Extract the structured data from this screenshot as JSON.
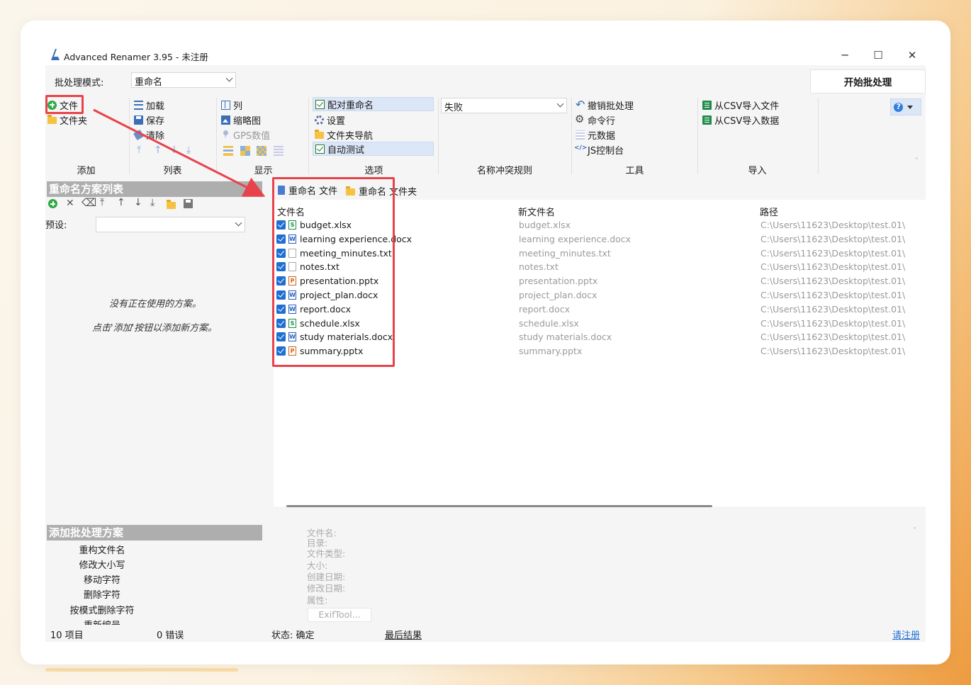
{
  "window": {
    "title": "Advanced Renamer 3.95 - 未注册",
    "minimize": "─",
    "maximize": "☐",
    "close": "✕"
  },
  "batch_mode": {
    "label": "批处理模式:",
    "value": "重命名"
  },
  "start_button": "开始批处理",
  "groups": {
    "add": {
      "label": "添加",
      "files": "文件",
      "folder": "文件夹"
    },
    "list": {
      "label": "列表",
      "load": "加载",
      "save": "保存",
      "clear": "清除"
    },
    "display": {
      "label": "显示",
      "columns": "列",
      "thumbnails": "缩略图",
      "gps": "GPS数值"
    },
    "options": {
      "label": "选项",
      "pair_rename": "配对重命名",
      "settings": "设置",
      "folder_nav": "文件夹导航",
      "auto_test": "自动测试"
    },
    "conflict": {
      "label": "名称冲突规则",
      "value": "失败"
    },
    "tools": {
      "label": "工具",
      "undo": "撤销批处理",
      "cmdline": "命令行",
      "metadata": "元数据",
      "js_console": "JS控制台"
    },
    "import": {
      "label": "导入",
      "csv_files": "从CSV导入文件",
      "csv_data": "从CSV导入数据"
    }
  },
  "left_panel": {
    "methods_header": "重命名方案列表",
    "preset_label": "预设:",
    "empty_msg1": "没有正在使用的方案。",
    "empty_msg2": "点击'添加'按钮以添加新方案。",
    "add_header": "添加批处理方案",
    "add_methods": [
      "重构文件名",
      "修改大小写",
      "移动字符",
      "删除字符",
      "按模式删除字符",
      "重新编号"
    ]
  },
  "tabs": [
    "重命名 文件",
    "重命名 文件夹"
  ],
  "columns": {
    "filename": "文件名",
    "new_filename": "新文件名",
    "path": "路径"
  },
  "files": [
    {
      "name": "budget.xlsx",
      "new": "budget.xlsx",
      "path": "C:\\Users\\11623\\Desktop\\test.01\\",
      "type": "x"
    },
    {
      "name": "learning experience.docx",
      "new": "learning experience.docx",
      "path": "C:\\Users\\11623\\Desktop\\test.01\\",
      "type": "w"
    },
    {
      "name": "meeting_minutes.txt",
      "new": "meeting_minutes.txt",
      "path": "C:\\Users\\11623\\Desktop\\test.01\\",
      "type": "t"
    },
    {
      "name": "notes.txt",
      "new": "notes.txt",
      "path": "C:\\Users\\11623\\Desktop\\test.01\\",
      "type": "t"
    },
    {
      "name": "presentation.pptx",
      "new": "presentation.pptx",
      "path": "C:\\Users\\11623\\Desktop\\test.01\\",
      "type": "p"
    },
    {
      "name": "project_plan.docx",
      "new": "project_plan.docx",
      "path": "C:\\Users\\11623\\Desktop\\test.01\\",
      "type": "w"
    },
    {
      "name": "report.docx",
      "new": "report.docx",
      "path": "C:\\Users\\11623\\Desktop\\test.01\\",
      "type": "w"
    },
    {
      "name": "schedule.xlsx",
      "new": "schedule.xlsx",
      "path": "C:\\Users\\11623\\Desktop\\test.01\\",
      "type": "x"
    },
    {
      "name": "study materials.docx",
      "new": "study materials.docx",
      "path": "C:\\Users\\11623\\Desktop\\test.01\\",
      "type": "w"
    },
    {
      "name": "summary.pptx",
      "new": "summary.pptx",
      "path": "C:\\Users\\11623\\Desktop\\test.01\\",
      "type": "p"
    }
  ],
  "file_info": {
    "filename": "文件名:",
    "directory": "目录:",
    "type": "文件类型:",
    "size": "大小:",
    "created": "创建日期:",
    "modified": "修改日期:",
    "attributes": "属性:",
    "exiftool": "ExifTool..."
  },
  "status": {
    "items": "10 项目",
    "errors": "0 错误",
    "state": "状态: 确定",
    "last_result": "最后结果",
    "register": "请注册"
  },
  "colors": {
    "highlight_red": "#e8434b",
    "accent_blue": "#1f6fd1"
  }
}
